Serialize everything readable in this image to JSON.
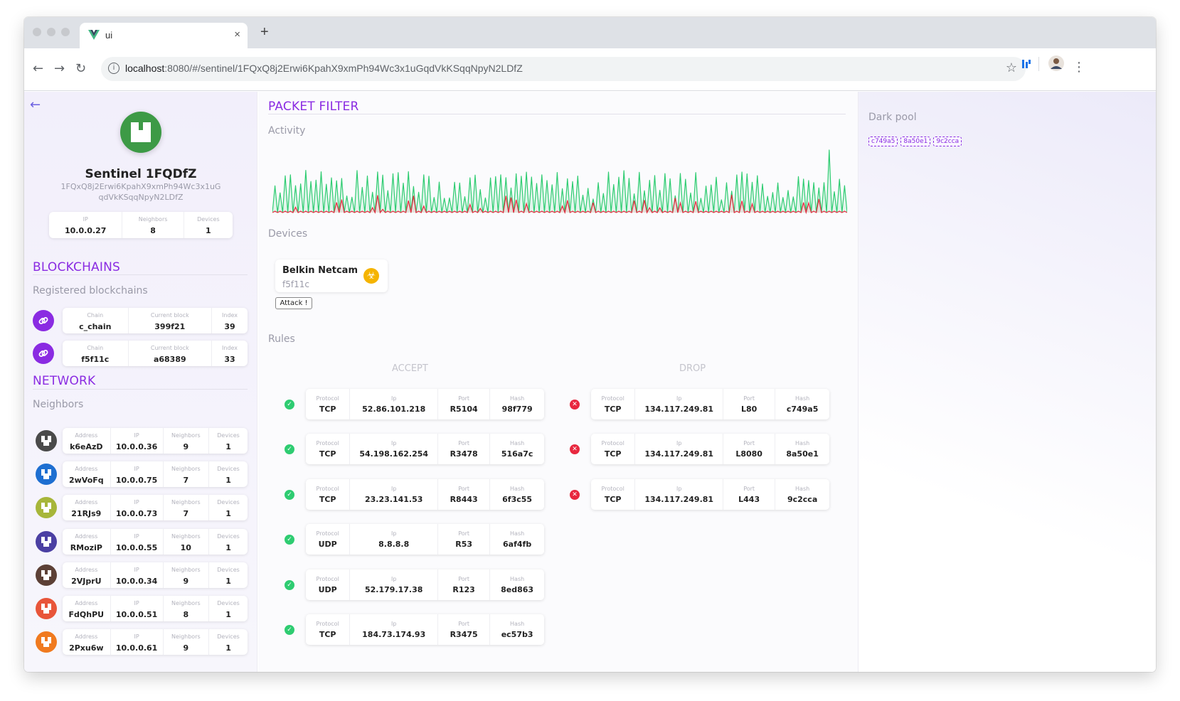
{
  "browser": {
    "tab_title": "ui",
    "tab_close": "×",
    "new_tab": "+",
    "url_host": "localhost",
    "url_rest": ":8080/#/sentinel/1FQxQ8j2Erwi6KpahX9xmPh94Wc3x1uGqdVkKSqqNpyN2LDfZ",
    "back": "←",
    "forward": "→",
    "reload": "↻",
    "star": "☆",
    "menu": "⋮"
  },
  "sentinel": {
    "name": "Sentinel 1FQDfZ",
    "id": "1FQxQ8j2Erwi6KpahX9xmPh94Wc3x1uGqdVkKSqqNpyN2LDfZ",
    "stats": [
      {
        "label": "IP",
        "value": "10.0.0.27"
      },
      {
        "label": "Neighbors",
        "value": "8"
      },
      {
        "label": "Devices",
        "value": "1"
      }
    ]
  },
  "blockchains": {
    "title": "BLOCKCHAINS",
    "subtitle": "Registered blockchains",
    "items": [
      {
        "chain": "c_chain",
        "block": "399f21",
        "index": "39"
      },
      {
        "chain": "f5f11c",
        "block": "a68389",
        "index": "33"
      }
    ],
    "labels": {
      "chain": "Chain",
      "block": "Current block",
      "index": "Index"
    }
  },
  "network": {
    "title": "NETWORK",
    "subtitle": "Neighbors",
    "labels": {
      "address": "Address",
      "ip": "IP",
      "neighbors": "Neighbors",
      "devices": "Devices"
    },
    "items": [
      {
        "address": "k6eAzD",
        "ip": "10.0.0.36",
        "neighbors": "9",
        "devices": "1",
        "color": "#4a4a4a"
      },
      {
        "address": "2wVoFq",
        "ip": "10.0.0.75",
        "neighbors": "7",
        "devices": "1",
        "color": "#1e6fd1"
      },
      {
        "address": "21RJs9",
        "ip": "10.0.0.73",
        "neighbors": "7",
        "devices": "1",
        "color": "#a7b63a"
      },
      {
        "address": "RMoziP",
        "ip": "10.0.0.55",
        "neighbors": "10",
        "devices": "1",
        "color": "#4b3fa3"
      },
      {
        "address": "2VJprU",
        "ip": "10.0.0.34",
        "neighbors": "9",
        "devices": "1",
        "color": "#5c4036"
      },
      {
        "address": "FdQhPU",
        "ip": "10.0.0.51",
        "neighbors": "8",
        "devices": "1",
        "color": "#e8553a"
      },
      {
        "address": "2Pxu6w",
        "ip": "10.0.0.61",
        "neighbors": "9",
        "devices": "1",
        "color": "#f07a1f"
      }
    ]
  },
  "packet_filter": {
    "title": "PACKET FILTER",
    "activity_label": "Activity",
    "devices_label": "Devices",
    "device": {
      "name": "Belkin Netcam",
      "hash": "f5f11c",
      "attack": "Attack !"
    },
    "rules_label": "Rules",
    "accept_label": "ACCEPT",
    "drop_label": "DROP",
    "labels": {
      "protocol": "Protocol",
      "ip": "Ip",
      "port": "Port",
      "hash": "Hash"
    },
    "accept": [
      {
        "protocol": "TCP",
        "ip": "52.86.101.218",
        "port": "R5104",
        "hash": "98f779"
      },
      {
        "protocol": "TCP",
        "ip": "54.198.162.254",
        "port": "R3478",
        "hash": "516a7c"
      },
      {
        "protocol": "TCP",
        "ip": "23.23.141.53",
        "port": "R8443",
        "hash": "6f3c55"
      },
      {
        "protocol": "UDP",
        "ip": "8.8.8.8",
        "port": "R53",
        "hash": "6af4fb"
      },
      {
        "protocol": "UDP",
        "ip": "52.179.17.38",
        "port": "R123",
        "hash": "8ed863"
      },
      {
        "protocol": "TCP",
        "ip": "184.73.174.93",
        "port": "R3475",
        "hash": "ec57b3"
      }
    ],
    "drop": [
      {
        "protocol": "TCP",
        "ip": "134.117.249.81",
        "port": "L80",
        "hash": "c749a5"
      },
      {
        "protocol": "TCP",
        "ip": "134.117.249.81",
        "port": "L8080",
        "hash": "8a50e1"
      },
      {
        "protocol": "TCP",
        "ip": "134.117.249.81",
        "port": "L443",
        "hash": "9c2cca"
      }
    ],
    "colors": {
      "accept_line": "#2ecc71",
      "drop_line": "#e8283f"
    }
  },
  "dark_pool": {
    "title": "Dark pool",
    "chips": [
      "c749a5",
      "8a50e1",
      "9c2cca"
    ]
  },
  "theme": {
    "accent": "#8a2be2"
  }
}
